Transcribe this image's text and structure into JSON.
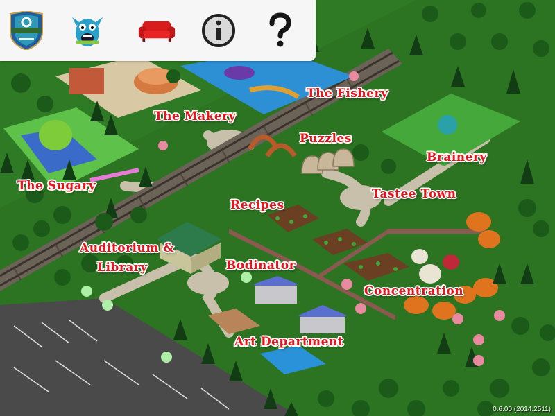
{
  "toolbar": {
    "badge_icon": "shield-badge-icon",
    "monster_icon": "monster-icon",
    "sofa_icon": "sofa-icon",
    "info_icon": "info-icon",
    "help_icon": "question-mark-icon"
  },
  "locations": {
    "makery": "The Makery",
    "fishery": "The Fishery",
    "sugary": "The Sugary",
    "puzzles": "Puzzles",
    "brainery": "Brainery",
    "tastee_town": "Tastee Town",
    "recipes": "Recipes",
    "auditorium_1": "Auditorium &",
    "auditorium_2": "Library",
    "bodinator": "Bodinator",
    "concentration": "Concentration",
    "art_department": "Art Department"
  },
  "version": "0.6.00 (2014.2511)",
  "colors": {
    "label_red": "#e8141c",
    "grass": "#2f7a24",
    "toolbar_bg": "#f6f6f6"
  }
}
